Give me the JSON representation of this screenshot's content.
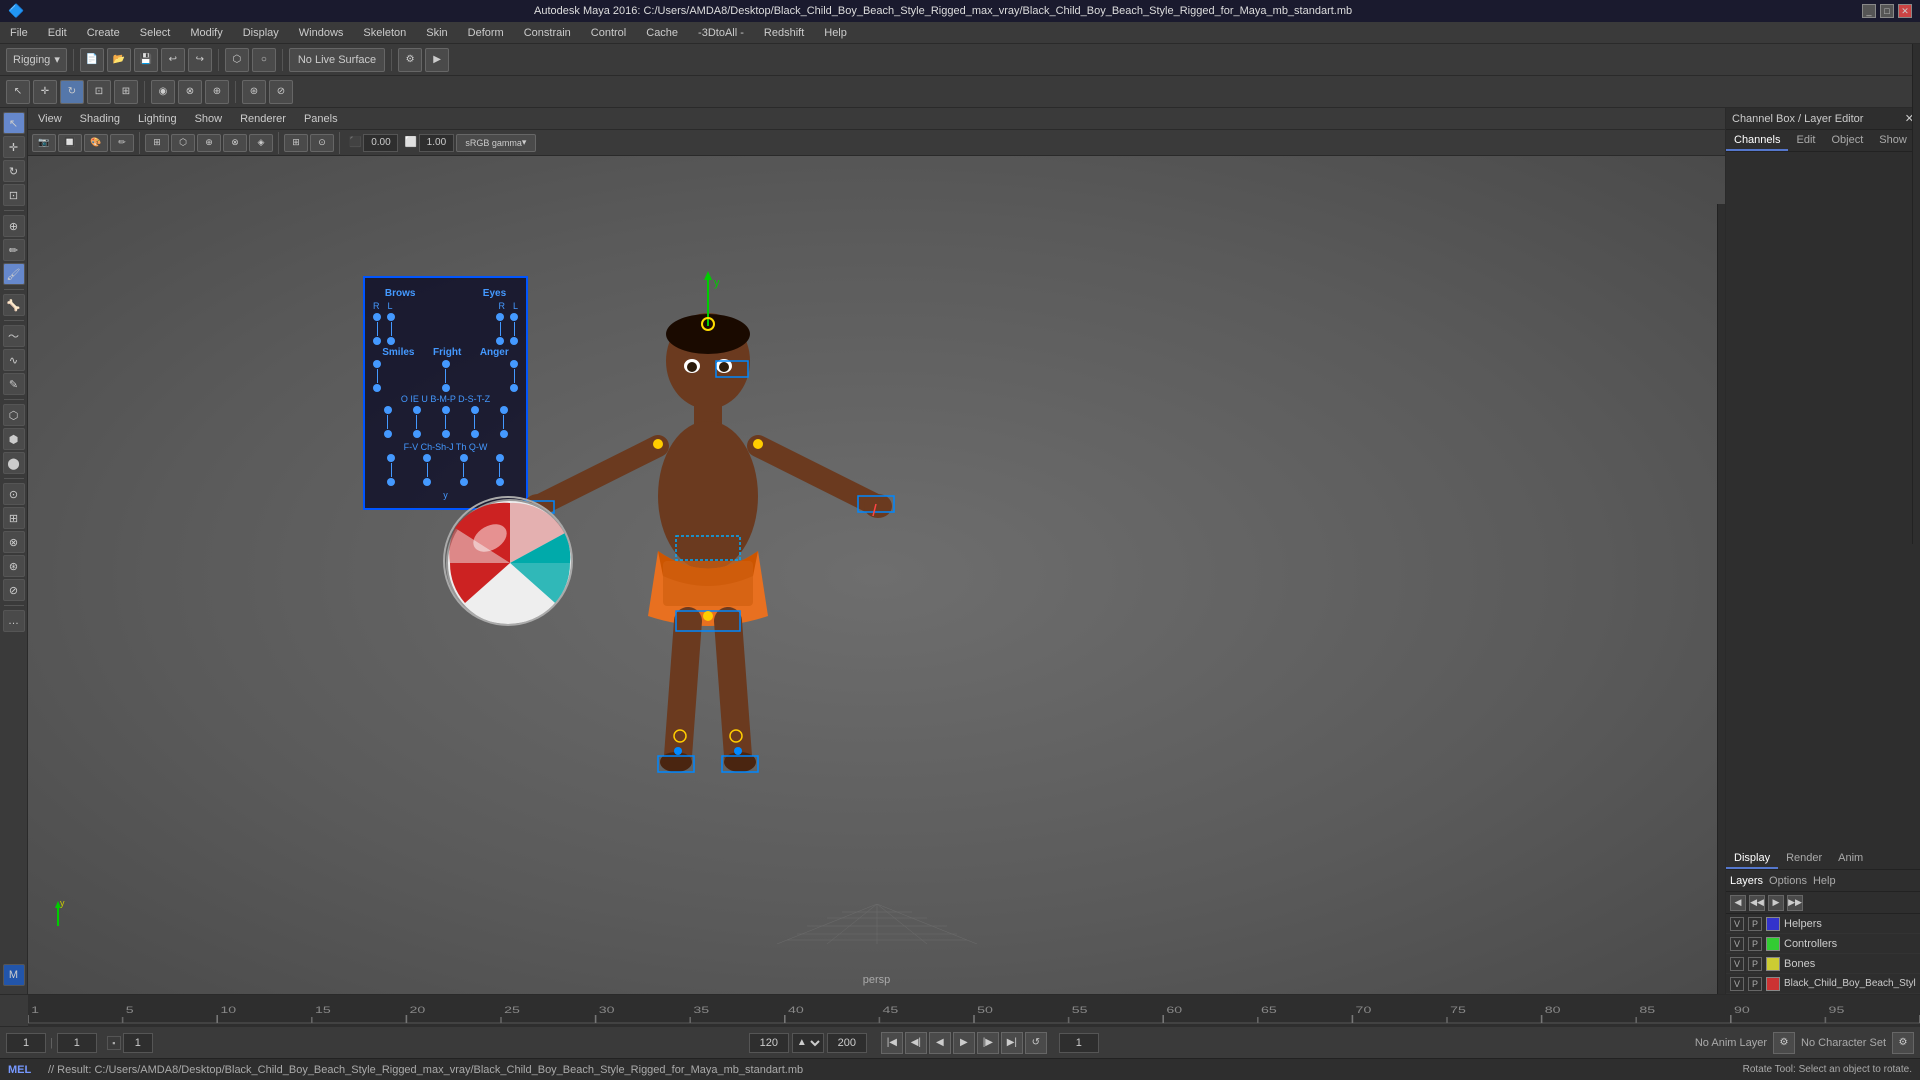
{
  "window": {
    "title": "Autodesk Maya 2016: C:/Users/AMDA8/Desktop/Black_Child_Boy_Beach_Style_Rigged_max_vray/Black_Child_Boy_Beach_Style_Rigged_for_Maya_mb_standart.mb"
  },
  "menubar": {
    "items": [
      "File",
      "Edit",
      "Create",
      "Select",
      "Modify",
      "Display",
      "Windows",
      "Skeleton",
      "Skin",
      "Deform",
      "Constrain",
      "Control",
      "Cache",
      "-3DtoAll -",
      "Redshift",
      "Help"
    ]
  },
  "toolbar1": {
    "mode_dropdown": "Rigging",
    "live_surface": "No Live Surface"
  },
  "viewport": {
    "menu_items": [
      "View",
      "Shading",
      "Lighting",
      "Show",
      "Renderer",
      "Panels"
    ],
    "camera": "persp",
    "gamma": "sRGB gamma",
    "gamma_value": "0.00",
    "gain_value": "1.00"
  },
  "right_panel": {
    "title": "Channel Box / Layer Editor",
    "tabs": [
      "Channels",
      "Edit",
      "Object",
      "Show"
    ],
    "display_tabs": [
      "Display",
      "Render",
      "Anim"
    ],
    "layer_tabs": [
      "Layers",
      "Options",
      "Help"
    ],
    "layers": [
      {
        "v": "V",
        "p": "P",
        "color": "#3333cc",
        "name": "Helpers"
      },
      {
        "v": "V",
        "p": "P",
        "color": "#33cc33",
        "name": "Controllers"
      },
      {
        "v": "V",
        "p": "P",
        "color": "#cccc33",
        "name": "Bones"
      },
      {
        "v": "V",
        "p": "P",
        "color": "#cc3333",
        "name": "Black_Child_Boy_Beach_Styl"
      }
    ]
  },
  "face_controls": {
    "title": "Brows",
    "title2": "Eyes",
    "row1_labels": [
      "R",
      "L",
      "R",
      "L"
    ],
    "smiles": "Smiles",
    "fright": "Fright",
    "anger": "Anger",
    "phonemes1": "O IE U B-M-P D-S-T-Z",
    "phonemes2": "F-V Ch-Sh-J Th Q-W"
  },
  "timeline": {
    "start": "1",
    "end": "120",
    "current": "1",
    "range_start": "1",
    "range_end": "120",
    "anim_end": "200"
  },
  "statusbar": {
    "lang": "MEL",
    "result": "// Result: C:/Users/AMDA8/Desktop/Black_Child_Boy_Beach_Style_Rigged_max_vray/Black_Child_Boy_Beach_Style_Rigged_for_Maya_mb_standart.mb",
    "no_anim_layer": "No Anim Layer",
    "no_character_set": "No Character Set"
  },
  "axes": {
    "label": "y"
  },
  "icons": {
    "arrow": "↑",
    "rotate": "↻",
    "scale": "⊡",
    "move": "✛",
    "menu_arrow": "▾",
    "play": "▶",
    "play_back": "◀",
    "play_all": "▶▶",
    "stop": "■",
    "prev_key": "⏮",
    "next_key": "⏭",
    "rewind": "⏪",
    "ff": "⏩",
    "step_back": "◁",
    "step_fwd": "▷"
  }
}
